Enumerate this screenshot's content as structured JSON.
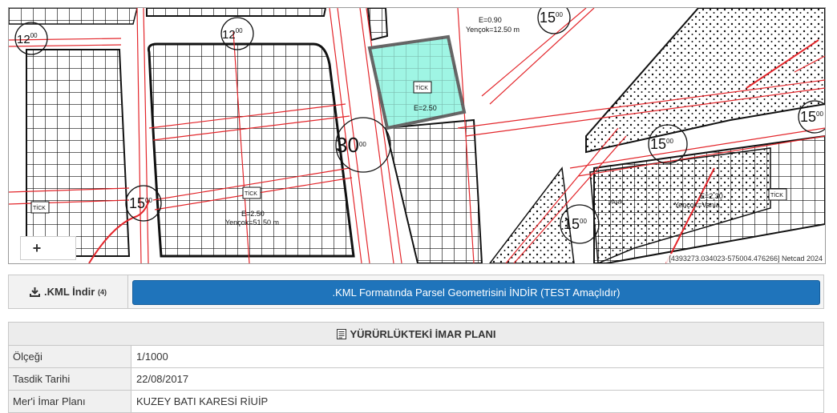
{
  "map": {
    "attribution": "[4393273.034023-575004.476266] Netcad 2024",
    "zoom_in_label": "+",
    "labels": {
      "road_widths": [
        "12",
        "12",
        "15",
        "15",
        "15",
        "15",
        "30",
        "15"
      ],
      "width_superscript": "00",
      "parcel_e_top": "E=0.90",
      "parcel_yencok_top": "Yençok=12.50 m",
      "parcel_e_selected": "E=2.50",
      "parcel_e_left": "E=2.50",
      "parcel_yencok_left": "Yençok=51.50 m",
      "parcel_e_right": "E=2.30",
      "parcel_yencok_right": "Yençok=Vania",
      "tick": "TİCK",
      "park": "PARK"
    },
    "colors": {
      "selected_fill": "#9ff5e4",
      "selected_border": "#666666",
      "road_line": "#e3262b",
      "grid": "#111111"
    }
  },
  "kml": {
    "label": ".KML İndir",
    "label_sup": "(4)",
    "button": ".KML Formatında Parsel Geometrisini İNDİR (TEST Amaçlıdır)"
  },
  "plan": {
    "title": "YÜRÜRLÜKTEKİ İMAR PLANI",
    "rows": [
      {
        "key": "Ölçeği",
        "value": "1/1000"
      },
      {
        "key": "Tasdik Tarihi",
        "value": "22/08/2017"
      },
      {
        "key": "Mer'i İmar Planı",
        "value": "KUZEY BATI KARESİ RİUİP"
      }
    ]
  }
}
